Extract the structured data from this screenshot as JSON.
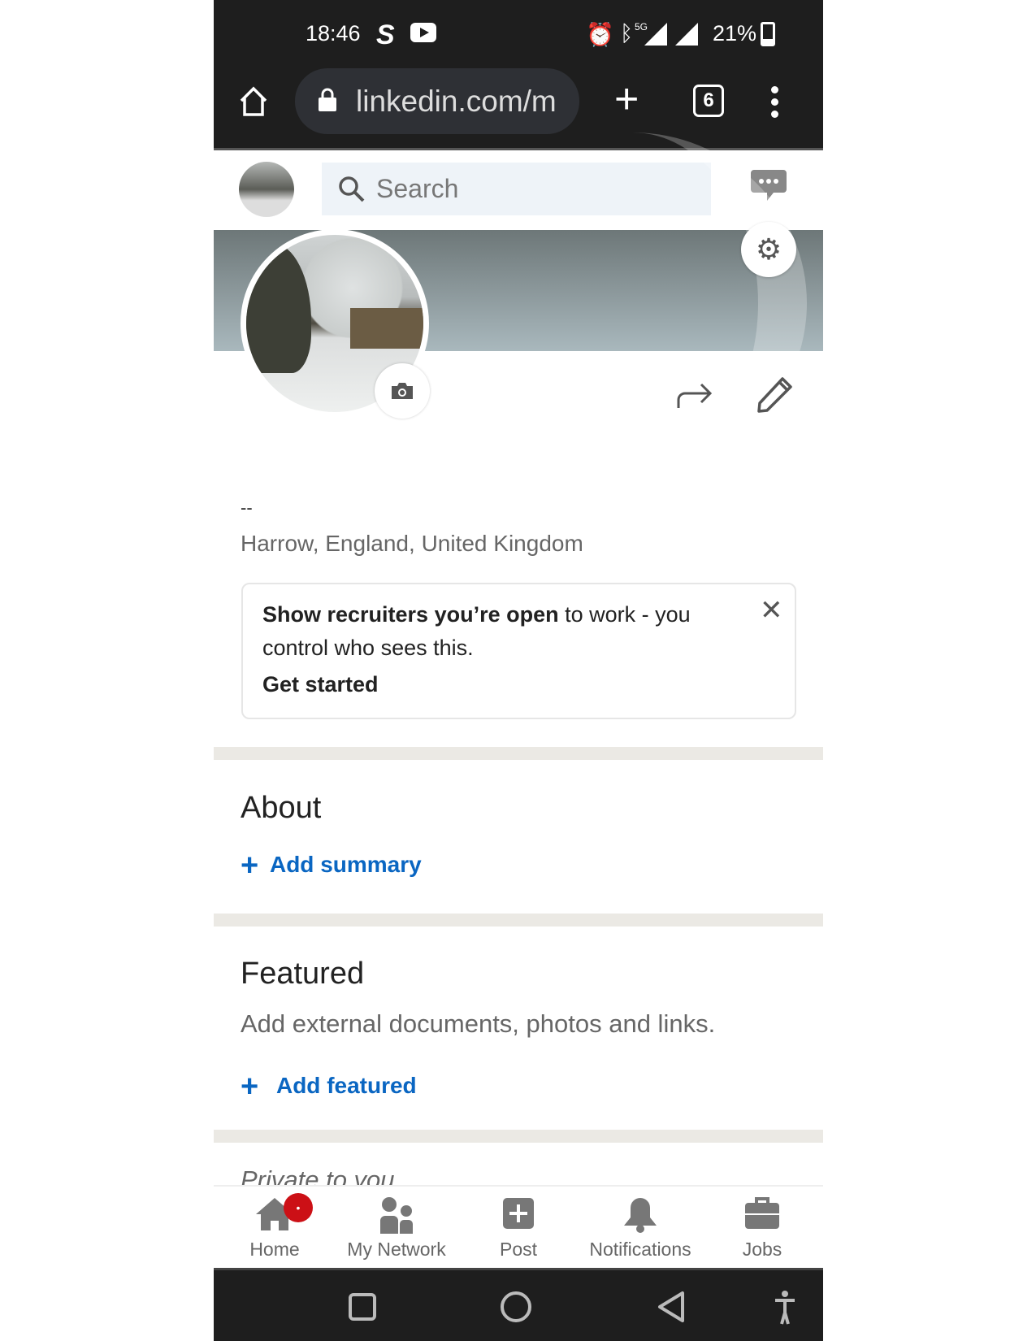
{
  "status_bar": {
    "time": "18:46",
    "battery": "21%",
    "network": "5G",
    "icons": [
      "skype-icon",
      "youtube-icon",
      "alarm-icon",
      "bluetooth-icon",
      "signal-icon",
      "battery-icon"
    ]
  },
  "browser": {
    "url": "linkedin.com/m",
    "tab_count": "6"
  },
  "header": {
    "search_placeholder": "Search"
  },
  "profile": {
    "headline": "--",
    "location": "Harrow, England, United Kingdom"
  },
  "open_to_work_card": {
    "bold_text": "Show recruiters you’re open",
    "text": " to work - you",
    "line2": "control who sees this.",
    "link": "Get started"
  },
  "about": {
    "title": "About",
    "action": "Add summary"
  },
  "featured": {
    "title": "Featured",
    "description": "Add external documents, photos and links.",
    "action": "Add featured"
  },
  "private": {
    "title": "Private to you"
  },
  "bottom_nav": [
    {
      "label": "Home",
      "badge": "•"
    },
    {
      "label": "My Network"
    },
    {
      "label": "Post"
    },
    {
      "label": "Notifications"
    },
    {
      "label": "Jobs"
    }
  ],
  "colors": {
    "accent": "#0a66c2",
    "badge": "#cc1016",
    "separator": "#ebe9e4"
  }
}
